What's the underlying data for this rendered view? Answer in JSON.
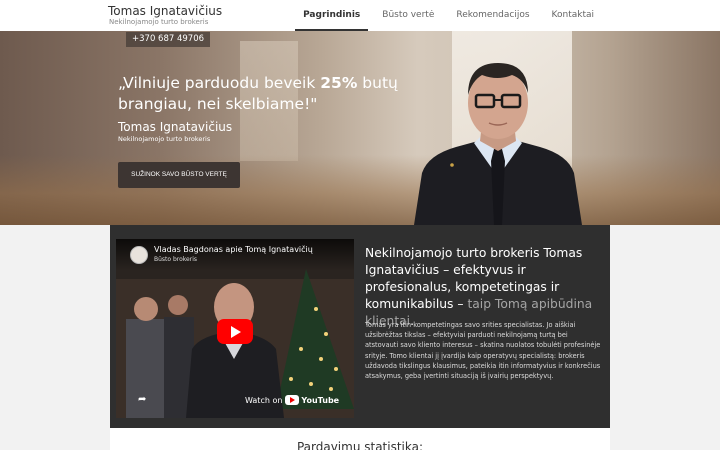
{
  "header": {
    "brand_name": "Tomas Ignatavičius",
    "brand_sub": "Nekilnojamojo turto brokeris",
    "nav": [
      {
        "label": "Pagrindinis",
        "active": true
      },
      {
        "label": "Būsto vertė",
        "active": false
      },
      {
        "label": "Rekomendacijos",
        "active": false
      },
      {
        "label": "Kontaktai",
        "active": false
      }
    ]
  },
  "hero": {
    "phone": "+370 687 49706",
    "quote_a": "„Vilniuje parduodu beveik ",
    "quote_bold": "25%",
    "quote_b": " butų brangiau, nei skelbiame!\"",
    "name": "Tomas Ignatavičius",
    "role": "Nekilnojamojo turto brokeris",
    "cta": "SUŽINOK SAVO BŪSTO VERTĘ"
  },
  "video": {
    "title": "Vladas Bagdonas apie Tomą Ignatavičių",
    "channel": "Būsto brokeris",
    "watch_on": "Watch on",
    "youtube": "YouTube"
  },
  "about": {
    "intro_main": "Nekilnojamojo turto brokeris Tomas Ignatavičius – efektyvus ir profesionalus, kompetetingas ir komunikabilus – ",
    "intro_muted": "taip Tomą apibūdina klientai",
    "intro_end": ".",
    "body": "Tomas yra itin kompetetingas savo srities specialistas. Jo aiškiai užsibrėžtas tikslas – efektyviai parduoti nekilnojamą turtą bei atstovauti savo kliento interesus – skatina nuolatos tobulėti profesinėje srityje. Tomo klientai jį įvardija kaip operatyvų specialistą: brokeris uždavoda tikslingus klausimus, pateikia itin informatyvius ir konkrečius atsakymus, geba įvertinti situaciją iš įvairių perspektyvų."
  },
  "stats": {
    "title": "Pardavimų statistika:"
  },
  "colors": {
    "dark_panel": "#2f2f2f",
    "cta_bg": "#3d3532",
    "youtube_red": "#ff0000"
  }
}
